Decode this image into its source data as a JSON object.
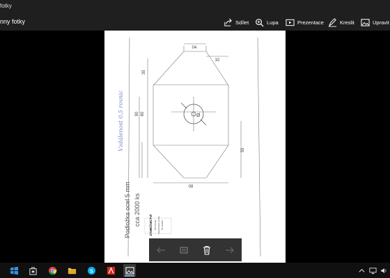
{
  "window": {
    "title": "fotky"
  },
  "header": {
    "breadcrumb": "nny fotky"
  },
  "toolbar": {
    "share_label": "Sdílet",
    "zoom_label": "Lupa",
    "slideshow_label": "Prezentace",
    "draw_label": "Kreslit",
    "edit_label": "Upravit"
  },
  "drawing": {
    "dim_top": "04",
    "dim_top_right": "32",
    "dim_left_upper": "35",
    "dim_left_mid_a": "60",
    "dim_left_mid_b": "90",
    "dim_right": "55",
    "dim_bottom": "08",
    "hole_label": "Ø",
    "side_note": "Vzdálenost 0,5 rovnic",
    "title_line1": "Podložka ocel 5 mm",
    "title_line2": "cca 2000 ks",
    "stamp_title": "ZÁMEČNICTVÍ",
    "stamp_line1": "Petr Novák",
    "stamp_line2": "Zámečnická výroba",
    "stamp_line3": "IČ 123456"
  },
  "taskbar": {
    "apps": [
      "windows-start",
      "task-view",
      "file-store",
      "chrome",
      "file-explorer",
      "skype",
      "acrobat",
      "photos"
    ],
    "active_app": "photos"
  },
  "colors": {
    "background": "#000000",
    "toolbar": "#1f1f1f",
    "taskbar": "#101010",
    "accent": "#7aa7d8"
  }
}
